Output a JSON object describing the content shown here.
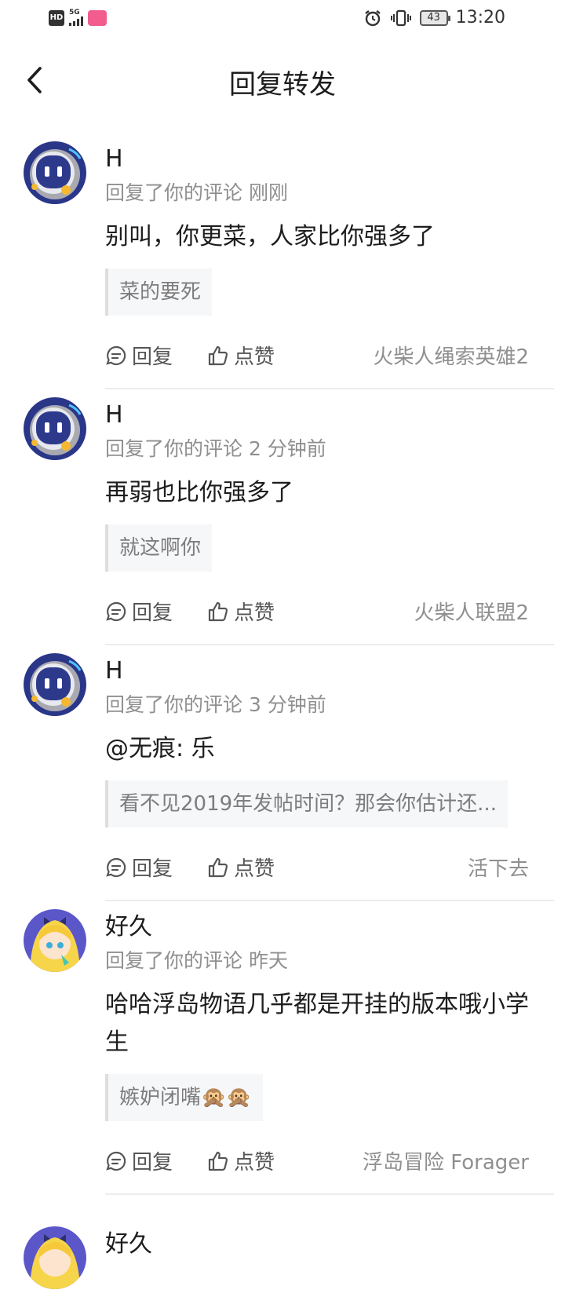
{
  "status_bar": {
    "hd": "HD",
    "network": "5G",
    "battery": "43",
    "time": "13:20"
  },
  "nav": {
    "title": "回复转发"
  },
  "labels": {
    "reply": "回复",
    "like": "点赞"
  },
  "items": [
    {
      "user": "H",
      "meta": "回复了你的评论 刚刚",
      "text": "别叫，你更菜，人家比你强多了",
      "quote": "菜的要死",
      "source": "火柴人绳索英雄2"
    },
    {
      "user": "H",
      "meta": "回复了你的评论 2 分钟前",
      "text": "再弱也比你强多了",
      "quote": "就这啊你",
      "source": "火柴人联盟2"
    },
    {
      "user": "H",
      "meta": "回复了你的评论 3 分钟前",
      "text": "@无痕: 乐",
      "quote": "看不见2019年发帖时间？那会你估计还...",
      "source": "活下去"
    },
    {
      "user": "好久",
      "meta": "回复了你的评论 昨天",
      "text": "哈哈浮岛物语几乎都是开挂的版本哦小学生",
      "quote": "嫉妒闭嘴🙊🙊",
      "source": "浮岛冒险 Forager"
    },
    {
      "user": "好久"
    }
  ],
  "colors": {
    "accent": "#2d3a8c",
    "muted": "#8f8f8f"
  }
}
